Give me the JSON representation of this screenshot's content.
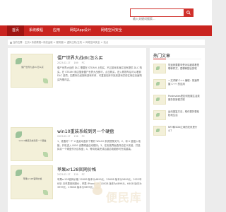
{
  "header": {
    "search_placeholder": "输入关键词搜索..."
  },
  "nav": {
    "items": [
      "首页",
      "系统教程",
      "应用",
      "网站App设计",
      "网络空间安全"
    ]
  },
  "breadcrumb": "当前位置：主页>系统教程>系统运维 > 服务器 > 虚拟主机/主机 > 网络空间安全 > 站点",
  "posts": [
    {
      "thumb_text": "僵尸世界大战dlc怎么买",
      "title": "僵尸世界大战dlc怎么买",
      "date": "2023-02-17",
      "views": "169",
      "category": "PC",
      "body": "僵尸世界大战的 DLC 需要在 STEAM 上购买。不过游戏本身并没有提供 DLC 购买。在 STEAM 商店搜索僵尸世界大战即可，点击购买，进入购物车后可以看到 DLC 选项。如果你已经拥有游戏本体，可直接在库中找到游戏并前往商店页面购买所需内容。"
    },
    {
      "thumb_text": "win10重装系统到另一个硬盘",
      "title": "win10重装系统到另一个硬盘",
      "date": "2023-02-17",
      "views": "136",
      "category": "PC",
      "body": "1、准备好一个 U 盘启动盘并下载好 Win10 系统镜像文件；2、将 U 盘插入电脑，开机进入 BIOS 设置硬盘启动顺序；3、在安装界面选择自定义安装，并选择另一个硬盘作为目标盘；4、等待安装完成后重启电脑即可完成重装。"
    },
    {
      "thumb_text": "苹果xr128官网价格",
      "title": "苹果xr128官网价格",
      "date": "2023-02-17",
      "views": "139",
      "category": "PC",
      "body": "苹果xr128官网价格 128GB 版本为4899元，256GB 版本为5699元。2022年8月1日苹果官网报价，苹果 iPhone XR 128GB 版本为4899元，64GB 版本为3999元，256GB 版本为5699元。"
    }
  ],
  "sidebar": {
    "title": "热门文章",
    "items": [
      "您迷家要要享受对话被观看是哪种样式，是哪种配合的呢",
      "一文详解 C++ 编程：快速掌握 C++ 的应用",
      "Postmates是如何拓展生活类服务的新模式呢",
      "运动康复方法，助你更好更轻松地生活",
      "NFV和SDN之间的关系是什么？"
    ]
  },
  "watermark": "便民库",
  "colors": {
    "brand_red": "#c9241f",
    "nav_active": "#9f1511"
  }
}
